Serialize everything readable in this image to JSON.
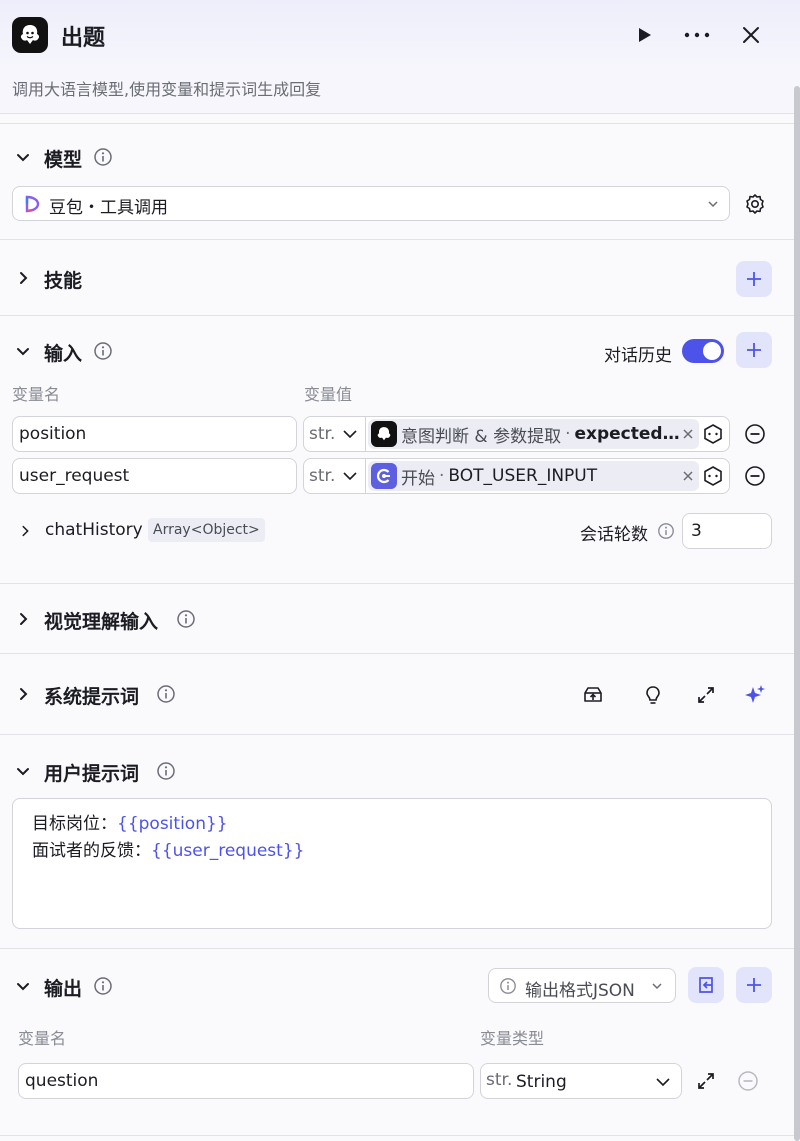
{
  "header": {
    "title": "出题",
    "subtitle": "调用大语言模型,使用变量和提示词生成回复"
  },
  "model": {
    "title": "模型",
    "selected": "豆包・工具调用"
  },
  "skills": {
    "title": "技能"
  },
  "input": {
    "title": "输入",
    "history_label": "对话历史",
    "col_name": "变量名",
    "col_value": "变量值",
    "rows": [
      {
        "name": "position",
        "type": "str.",
        "source": "意图判断 & 参数提取",
        "sep": "·",
        "ref": "expected…"
      },
      {
        "name": "user_request",
        "type": "str.",
        "source": "开始",
        "sep": "·",
        "ref": "BOT_USER_INPUT"
      }
    ],
    "chat_history": {
      "name": "chatHistory",
      "type": "Array<Object>",
      "rounds_label": "会话轮数",
      "rounds_value": "3"
    }
  },
  "vision": {
    "title": "视觉理解输入"
  },
  "system_prompt": {
    "title": "系统提示词"
  },
  "user_prompt": {
    "title": "用户提示词",
    "line1_label": "目标岗位：",
    "line1_var": "{{position}}",
    "line2_label": "面试者的反馈：",
    "line2_var": "{{user_request}}"
  },
  "output": {
    "title": "输出",
    "format_label": "输出格式JSON",
    "col_name": "变量名",
    "col_type": "变量类型",
    "rows": [
      {
        "name": "question",
        "type_prefix": "str.",
        "type": "String"
      }
    ]
  },
  "colors": {
    "accent": "#4d53e8",
    "accent_light": "#e2e4fb",
    "border": "#d3d4da",
    "background": "#fafafc"
  }
}
